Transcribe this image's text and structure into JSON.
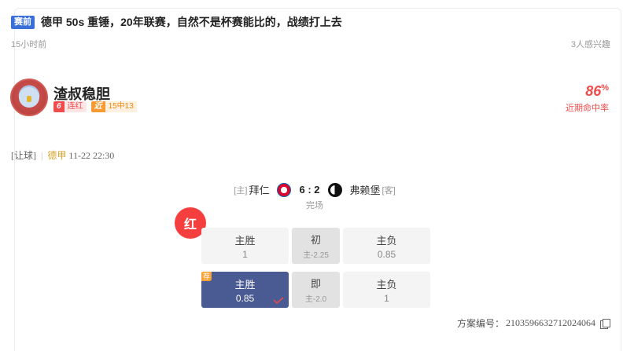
{
  "article": {
    "tag": "赛前",
    "title": "德甲 50s 重锤，20年联赛，自然不是杯赛能比的，战绩打上去",
    "time": "15小时前",
    "interest": "3人感兴趣"
  },
  "author": {
    "name": "渣叔稳胆",
    "streak_num": "6",
    "streak_label": "连红",
    "recent_num": "近",
    "recent_label": "15中13",
    "hit_rate_value": "86",
    "hit_rate_unit": "%",
    "hit_rate_label": "近期命中率"
  },
  "match_info": {
    "type": "[让球]",
    "separator": "|",
    "league": "德甲",
    "datetime": "11-22 22:30"
  },
  "match": {
    "home_tag": "[主]",
    "home_team": "拜仁",
    "score": "6 : 2",
    "away_team": "弗赖堡",
    "away_tag": "[客]",
    "status": "完场"
  },
  "result_badge": "红",
  "odds": {
    "initial": {
      "left_label": "主胜",
      "left_value": "1",
      "mid_label": "初",
      "mid_value": "主-2.25",
      "right_label": "主负",
      "right_value": "0.85"
    },
    "current": {
      "rec_tag": "荐",
      "left_label": "主胜",
      "left_value": "0.85",
      "mid_label": "即",
      "mid_value": "主-2.0",
      "right_label": "主负",
      "right_value": "1"
    }
  },
  "plan": {
    "label": "方案编号：",
    "code": "2103596632712024064"
  },
  "colors": {
    "accent_red": "#f24b4b",
    "picked_bg": "#4a5a92",
    "tag_blue": "#3a6fd8",
    "league_gold": "#d4a22a"
  },
  "icons": [
    "copy-icon",
    "check-icon",
    "bayern-logo",
    "freiburg-logo"
  ]
}
